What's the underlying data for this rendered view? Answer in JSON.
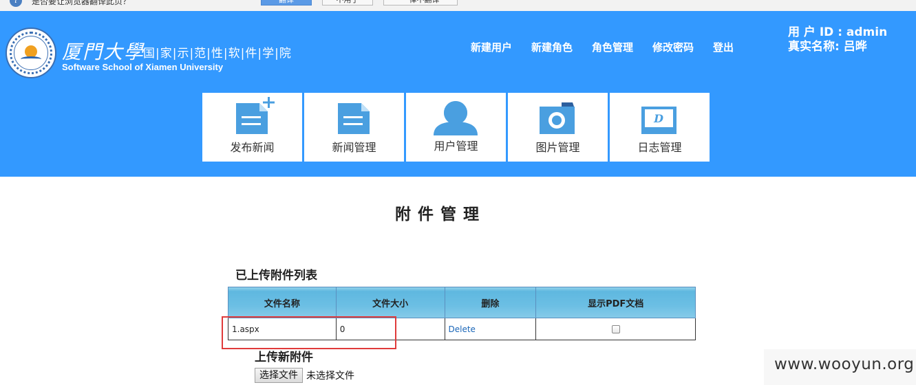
{
  "infobar": {
    "text": "是否要让浏览器翻译此页？",
    "translate_label": "翻译",
    "nope_label": "不用了",
    "never_label": "一律不翻译"
  },
  "header": {
    "university_cn": "厦門大學",
    "school_cn": "国|家|示|范|性|软|件|学|院",
    "school_en": "Software School of Xiamen University",
    "nav": [
      "新建用户",
      "新建角色",
      "角色管理",
      "修改密码",
      "登出"
    ],
    "user_id_line": "用 户 ID : admin",
    "real_name_line": "真实名称: 吕晔"
  },
  "tiles": [
    {
      "label": "发布新闻",
      "icon": "add-document-icon"
    },
    {
      "label": "新闻管理",
      "icon": "document-icon"
    },
    {
      "label": "用户管理",
      "icon": "user-icon"
    },
    {
      "label": "图片管理",
      "icon": "camera-icon"
    },
    {
      "label": "日志管理",
      "icon": "log-icon"
    }
  ],
  "main": {
    "title": "附件管理",
    "list_title": "已上传附件列表",
    "table": {
      "columns": [
        "文件名称",
        "文件大小",
        "删除",
        "显示PDF文档"
      ],
      "rows": [
        {
          "name": "1.aspx",
          "size": "0",
          "delete": "Delete",
          "show_pdf": false
        }
      ]
    },
    "upload_title": "上传新附件",
    "choose_file_label": "选择文件",
    "no_file_text": "未选择文件"
  },
  "watermark": "www.wooyun.org",
  "colors": {
    "header_bg": "#3399ff",
    "table_header_bg": "#6cbfe4",
    "highlight": "#e03a3a",
    "link": "#1a66b8"
  }
}
